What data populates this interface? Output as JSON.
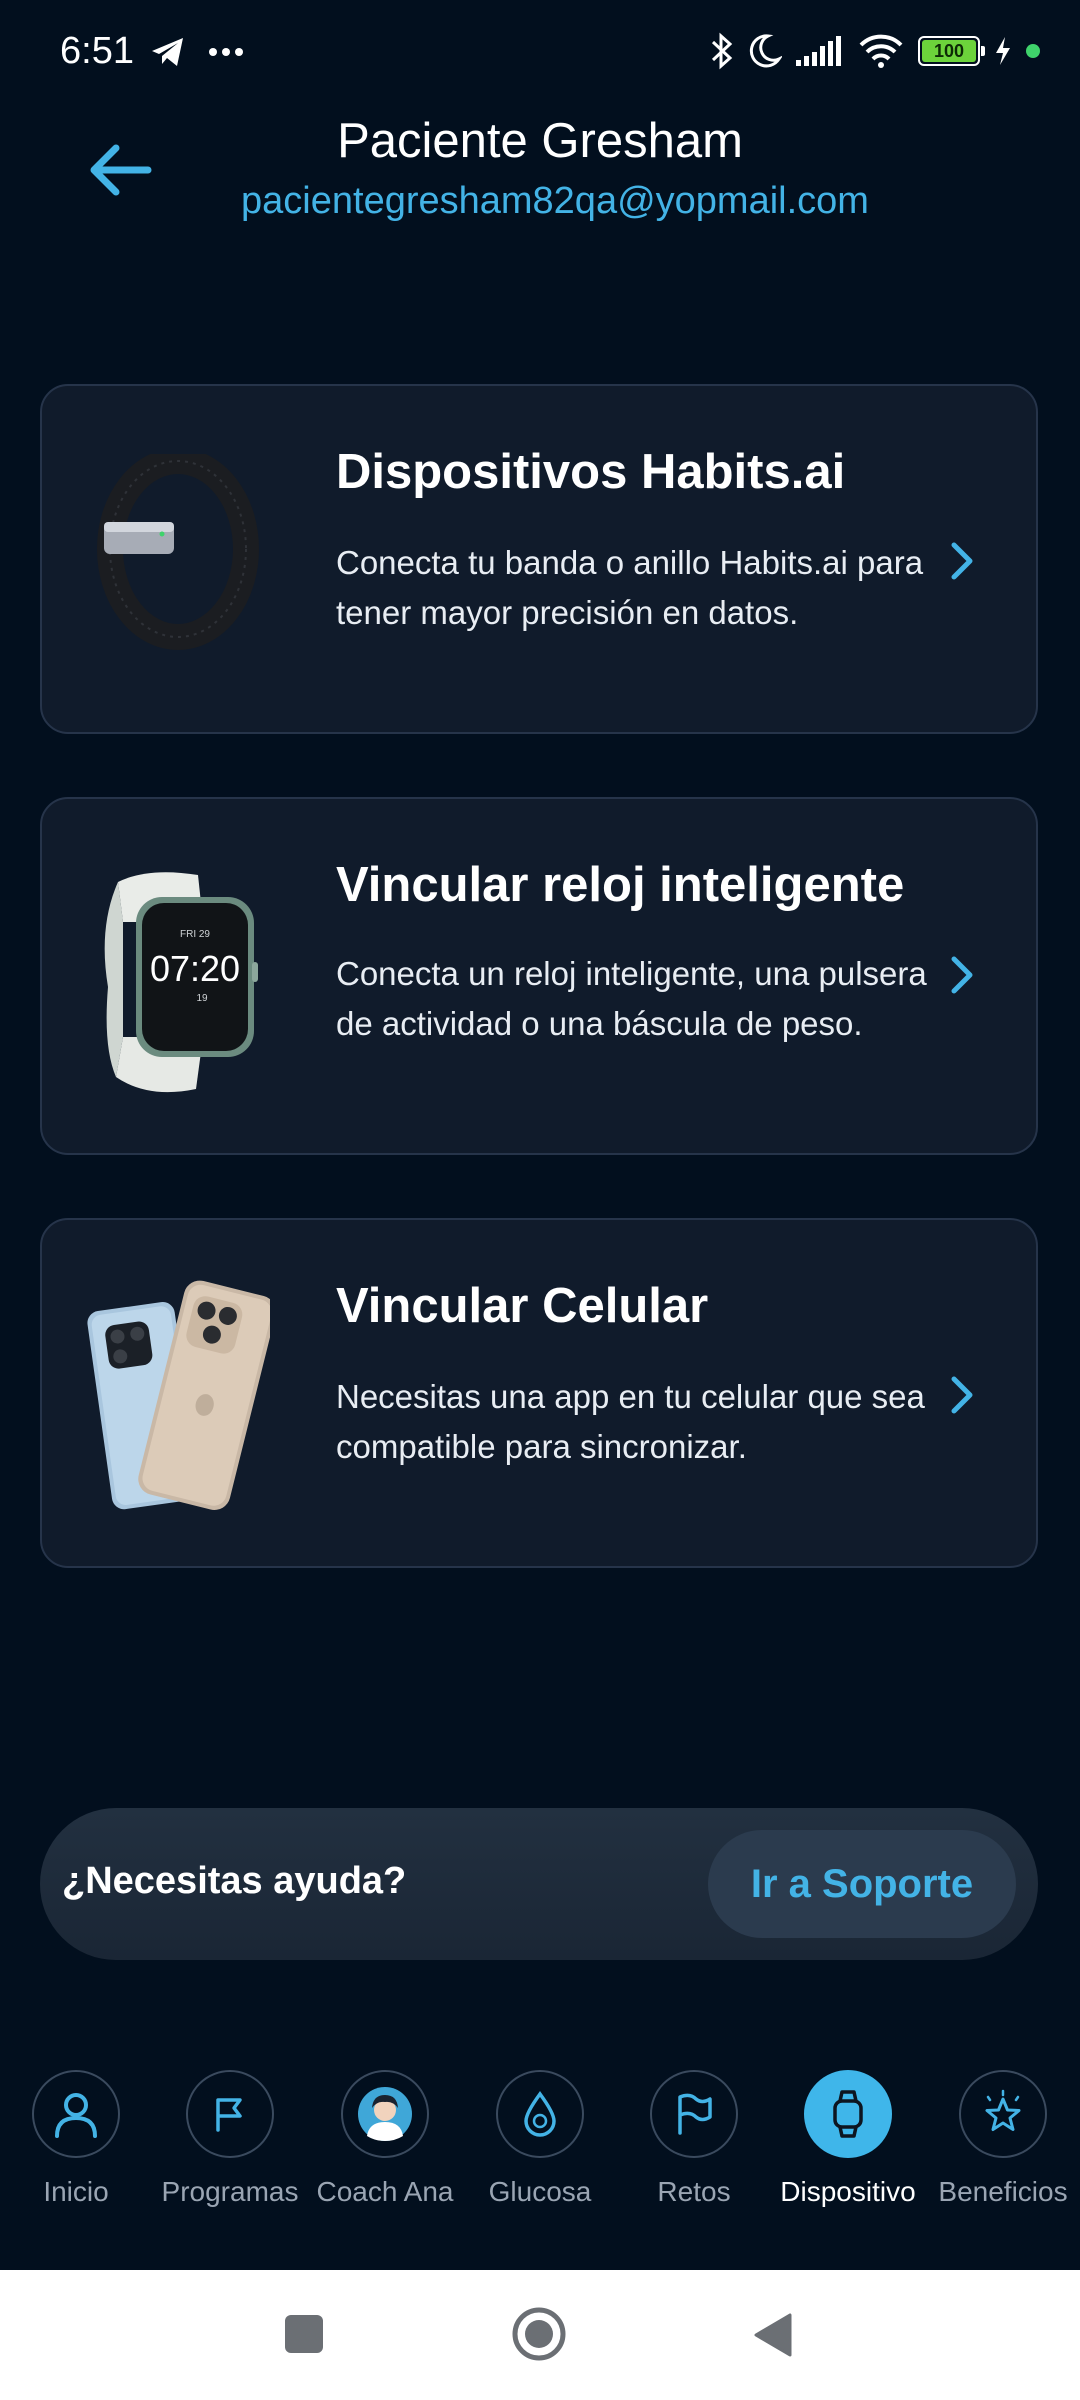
{
  "status_bar": {
    "time": "6:51",
    "battery": "100",
    "icons": [
      "telegram-icon",
      "more-dots-icon",
      "bluetooth-icon",
      "moon-icon",
      "signal-icon",
      "wifi-icon",
      "battery-icon",
      "charging-icon",
      "green-dot-icon"
    ]
  },
  "header": {
    "name": "Paciente Gresham",
    "email": "pacientegresham82qa@yopmail.com"
  },
  "cards": [
    {
      "title": "Dispositivos Habits.ai",
      "description": "Conecta tu banda o anillo Habits.ai para tener mayor precisión en datos."
    },
    {
      "title": "Vincular reloj inteligente",
      "description": "Conecta un reloj inteligente, una pulsera de actividad o una báscula de peso.",
      "watch_time": "07:20",
      "watch_date": "FRI 29",
      "watch_steps": "19"
    },
    {
      "title": "Vincular Celular",
      "description": "Necesitas una app en tu celular que sea compatible para sincronizar."
    }
  ],
  "help": {
    "text": "¿Necesitas ayuda?",
    "button_label": "Ir a Soporte"
  },
  "bottom_nav": {
    "items": [
      {
        "label": "Inicio",
        "icon": "user-icon"
      },
      {
        "label": "Programas",
        "icon": "flag-icon"
      },
      {
        "label": "Coach Ana",
        "icon": "coach-avatar-icon"
      },
      {
        "label": "Glucosa",
        "icon": "drop-icon"
      },
      {
        "label": "Retos",
        "icon": "flag-icon"
      },
      {
        "label": "Dispositivo",
        "icon": "watch-icon",
        "active": true
      },
      {
        "label": "Beneficios",
        "icon": "star-icon"
      }
    ],
    "active_color": "#3fb6ea"
  },
  "colors": {
    "background": "#020f1e",
    "card": "#101b2b",
    "accent": "#43b3e6"
  }
}
